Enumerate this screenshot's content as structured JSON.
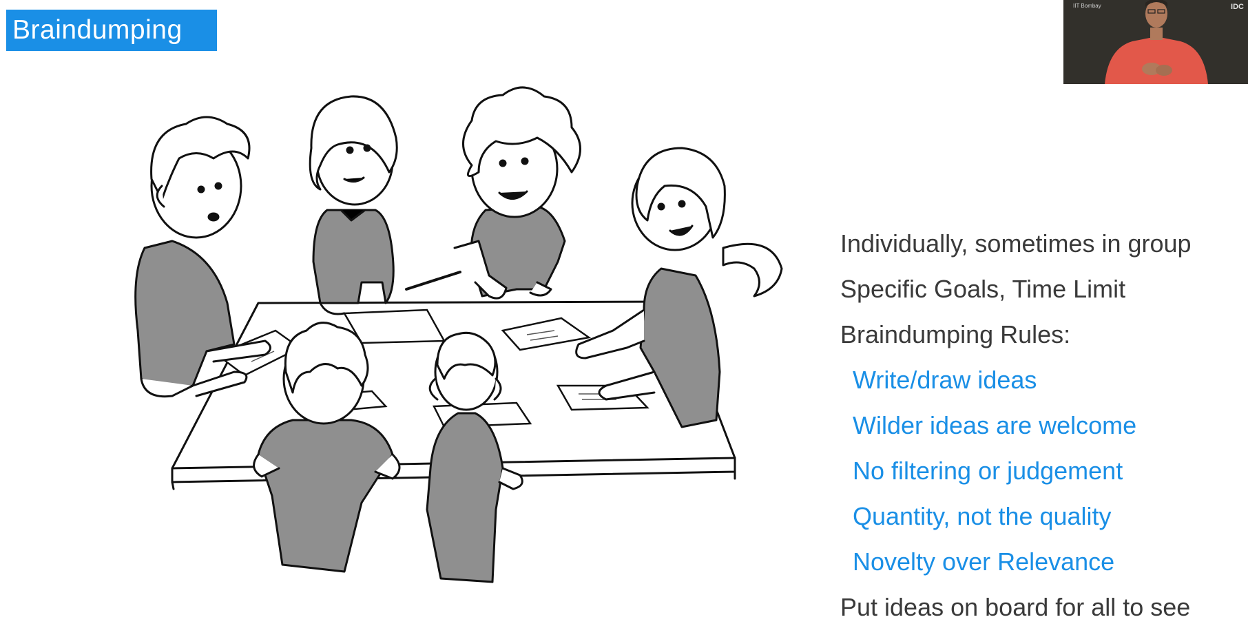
{
  "slide": {
    "title": "Braindumping",
    "accent_color": "#1a8fe6",
    "text_color": "#3a3a3a"
  },
  "illustration": {
    "description_icon": "group-brainstorm-illustration"
  },
  "webcam": {
    "logo_left": "IIT Bombay",
    "logo_right": "IDC"
  },
  "bullets": [
    {
      "text": "Individually, sometimes in group",
      "level": 1
    },
    {
      "text": "Specific Goals, Time Limit",
      "level": 1
    },
    {
      "text": "Braindumping Rules:",
      "level": 1
    },
    {
      "text": "Write/draw ideas",
      "level": 2
    },
    {
      "text": "Wilder ideas are welcome",
      "level": 2
    },
    {
      "text": "No filtering or judgement",
      "level": 2
    },
    {
      "text": "Quantity, not the quality",
      "level": 2
    },
    {
      "text": "Novelty over Relevance",
      "level": 2
    },
    {
      "text": "Put ideas on board for all to see",
      "level": 1
    }
  ]
}
